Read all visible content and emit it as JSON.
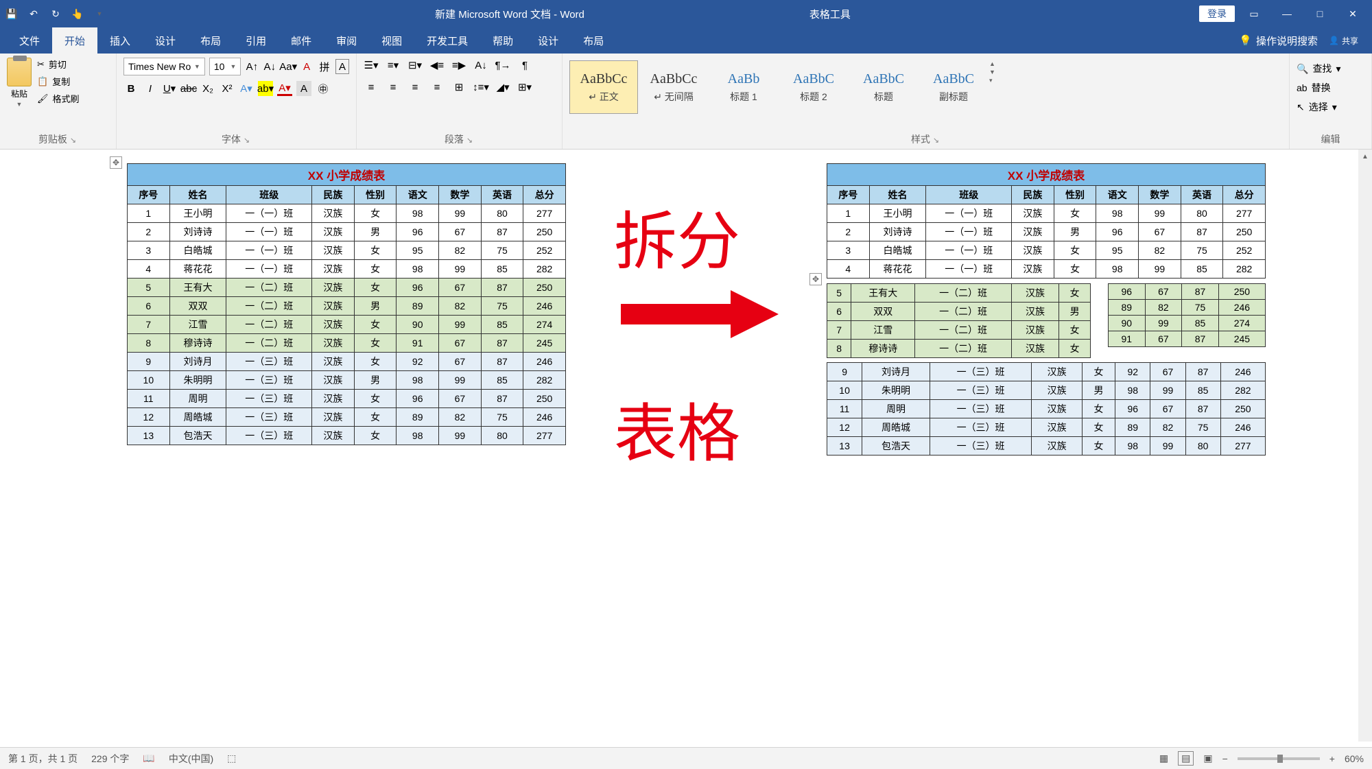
{
  "titlebar": {
    "doc_title": "新建 Microsoft Word 文档 - Word",
    "table_tools": "表格工具",
    "login": "登录"
  },
  "menu": {
    "tabs": [
      "文件",
      "开始",
      "插入",
      "设计",
      "布局",
      "引用",
      "邮件",
      "审阅",
      "视图",
      "开发工具",
      "帮助",
      "设计",
      "布局"
    ],
    "tell_me": "操作说明搜索",
    "share": "共享"
  },
  "ribbon": {
    "clipboard": {
      "paste": "粘贴",
      "cut": "剪切",
      "copy": "复制",
      "painter": "格式刷",
      "label": "剪贴板"
    },
    "font": {
      "name": "Times New Ro",
      "size": "10",
      "label": "字体"
    },
    "paragraph": {
      "label": "段落"
    },
    "styles": {
      "label": "样式",
      "items": [
        {
          "preview": "AaBbCc",
          "name": "↵ 正文"
        },
        {
          "preview": "AaBbCc",
          "name": "↵ 无间隔"
        },
        {
          "preview": "AaBb",
          "name": "标题 1"
        },
        {
          "preview": "AaBbC",
          "name": "标题 2"
        },
        {
          "preview": "AaBbC",
          "name": "标题"
        },
        {
          "preview": "AaBbC",
          "name": "副标题"
        }
      ]
    },
    "editing": {
      "find": "查找",
      "replace": "替换",
      "select": "选择",
      "label": "编辑"
    }
  },
  "table_title": "XX 小学成绩表",
  "headers": [
    "序号",
    "姓名",
    "班级",
    "民族",
    "性别",
    "语文",
    "数学",
    "英语",
    "总分"
  ],
  "rows": [
    {
      "c": [
        "1",
        "王小明",
        "一（一）班",
        "汉族",
        "女",
        "98",
        "99",
        "80",
        "277"
      ],
      "g": ""
    },
    {
      "c": [
        "2",
        "刘诗诗",
        "一（一）班",
        "汉族",
        "男",
        "96",
        "67",
        "87",
        "250"
      ],
      "g": ""
    },
    {
      "c": [
        "3",
        "白皓城",
        "一（一）班",
        "汉族",
        "女",
        "95",
        "82",
        "75",
        "252"
      ],
      "g": ""
    },
    {
      "c": [
        "4",
        "蒋花花",
        "一（一）班",
        "汉族",
        "女",
        "98",
        "99",
        "85",
        "282"
      ],
      "g": ""
    },
    {
      "c": [
        "5",
        "王有大",
        "一（二）班",
        "汉族",
        "女",
        "96",
        "67",
        "87",
        "250"
      ],
      "g": "g"
    },
    {
      "c": [
        "6",
        "双双",
        "一（二）班",
        "汉族",
        "男",
        "89",
        "82",
        "75",
        "246"
      ],
      "g": "g"
    },
    {
      "c": [
        "7",
        "江雪",
        "一（二）班",
        "汉族",
        "女",
        "90",
        "99",
        "85",
        "274"
      ],
      "g": "g"
    },
    {
      "c": [
        "8",
        "穆诗诗",
        "一（二）班",
        "汉族",
        "女",
        "91",
        "67",
        "87",
        "245"
      ],
      "g": "g"
    },
    {
      "c": [
        "9",
        "刘诗月",
        "一（三）班",
        "汉族",
        "女",
        "92",
        "67",
        "87",
        "246"
      ],
      "g": "b"
    },
    {
      "c": [
        "10",
        "朱明明",
        "一（三）班",
        "汉族",
        "男",
        "98",
        "99",
        "85",
        "282"
      ],
      "g": "b"
    },
    {
      "c": [
        "11",
        "周明",
        "一（三）班",
        "汉族",
        "女",
        "96",
        "67",
        "87",
        "250"
      ],
      "g": "b"
    },
    {
      "c": [
        "12",
        "周皓城",
        "一（三）班",
        "汉族",
        "女",
        "89",
        "82",
        "75",
        "246"
      ],
      "g": "b"
    },
    {
      "c": [
        "13",
        "包浩天",
        "一（三）班",
        "汉族",
        "女",
        "98",
        "99",
        "80",
        "277"
      ],
      "g": "b"
    }
  ],
  "overlay": {
    "split": "拆分",
    "table": "表格"
  },
  "status": {
    "page": "第 1 页，共 1 页",
    "words": "229 个字",
    "lang": "中文(中国)",
    "zoom": "60%"
  }
}
